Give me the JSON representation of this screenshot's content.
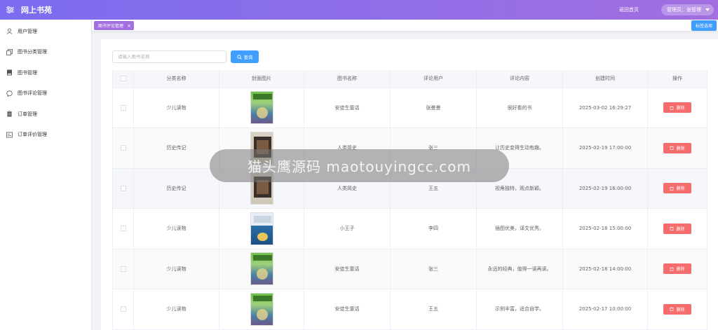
{
  "header": {
    "brand": "网上书苑",
    "home_link": "返回首页",
    "admin_label": "管理员：张管理"
  },
  "sidebar": {
    "items": [
      {
        "label": "用户管理",
        "icon": "user-icon"
      },
      {
        "label": "图书分类管理",
        "icon": "copy-icon"
      },
      {
        "label": "图书管理",
        "icon": "book-icon"
      },
      {
        "label": "图书评论管理",
        "icon": "chat-bubble-icon"
      },
      {
        "label": "订单管理",
        "icon": "clipboard-icon"
      },
      {
        "label": "订单评价管理",
        "icon": "review-icon"
      }
    ]
  },
  "tabs": {
    "active": "图书评论管理",
    "close": "×",
    "option": "标签选项"
  },
  "search": {
    "placeholder": "请输入图书名称",
    "button": "查询"
  },
  "table": {
    "columns": [
      "分类名称",
      "封面图片",
      "图书名称",
      "评论用户",
      "评论内容",
      "创建时间",
      "操作"
    ],
    "delete_label": "删除",
    "rows": [
      {
        "category": "少儿读物",
        "cover": "green",
        "book": "安徒生童话",
        "user": "张曼曼",
        "content": "很好看的书",
        "time": "2025-03-02 16:29:27"
      },
      {
        "category": "历史传记",
        "cover": "dark",
        "book": "人类简史",
        "user": "张三",
        "content": "让历史变得生动有趣。",
        "time": "2025-02-19 17:00:00"
      },
      {
        "category": "历史传记",
        "cover": "dark",
        "book": "人类简史",
        "user": "王五",
        "content": "视角独特，观点新颖。",
        "time": "2025-02-19 16:00:00"
      },
      {
        "category": "少儿读物",
        "cover": "blue",
        "book": "小王子",
        "user": "李四",
        "content": "插图优美，译文优秀。",
        "time": "2025-02-18 15:00:00"
      },
      {
        "category": "少儿读物",
        "cover": "green",
        "book": "安徒生童话",
        "user": "张三",
        "content": "永远的经典，值得一读再读。",
        "time": "2025-02-18 14:00:00"
      },
      {
        "category": "少儿读物",
        "cover": "green",
        "book": "安徒生童话",
        "user": "王五",
        "content": "示例丰富，适合自学。",
        "time": "2025-02-17 10:00:00"
      }
    ]
  },
  "watermark": "猫头鹰源码 maotouyingcc.com",
  "colors": {
    "header_gradient_start": "#7b6cf0",
    "header_gradient_end": "#a26ee0",
    "primary": "#409eff",
    "danger": "#f56c6c",
    "tab_active": "#a26ee0"
  }
}
